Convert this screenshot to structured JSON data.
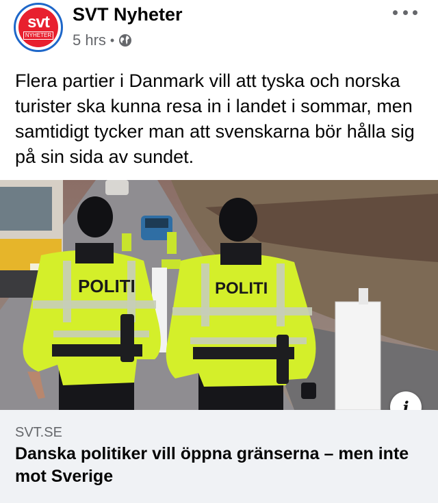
{
  "post": {
    "page_name": "SVT Nyheter",
    "avatar": {
      "logo_text": "svt",
      "logo_sub": "NYHETER"
    },
    "time": "5 hrs",
    "privacy_icon": "globe-icon",
    "more_icon": "more-horizontal-icon",
    "text": "Flera partier i Danmark vill att tyska och norska turister ska kunna resa in i landet i sommar, men samtidigt tycker man att svenskarna bör hålla sig på sin sida av sundet."
  },
  "link": {
    "image_icon": "info-icon",
    "info_glyph": "i",
    "image_badge_text": "POLITI",
    "domain": "SVT.SE",
    "headline": "Danska politiker vill öppna gränserna – men inte mot Sverige"
  },
  "colors": {
    "brand_red": "#e8202e",
    "brand_blue": "#1e67c9",
    "hi_vis_yellow": "#d4ef2a",
    "link_box_bg": "#f0f2f5",
    "secondary_text": "#65676b"
  }
}
